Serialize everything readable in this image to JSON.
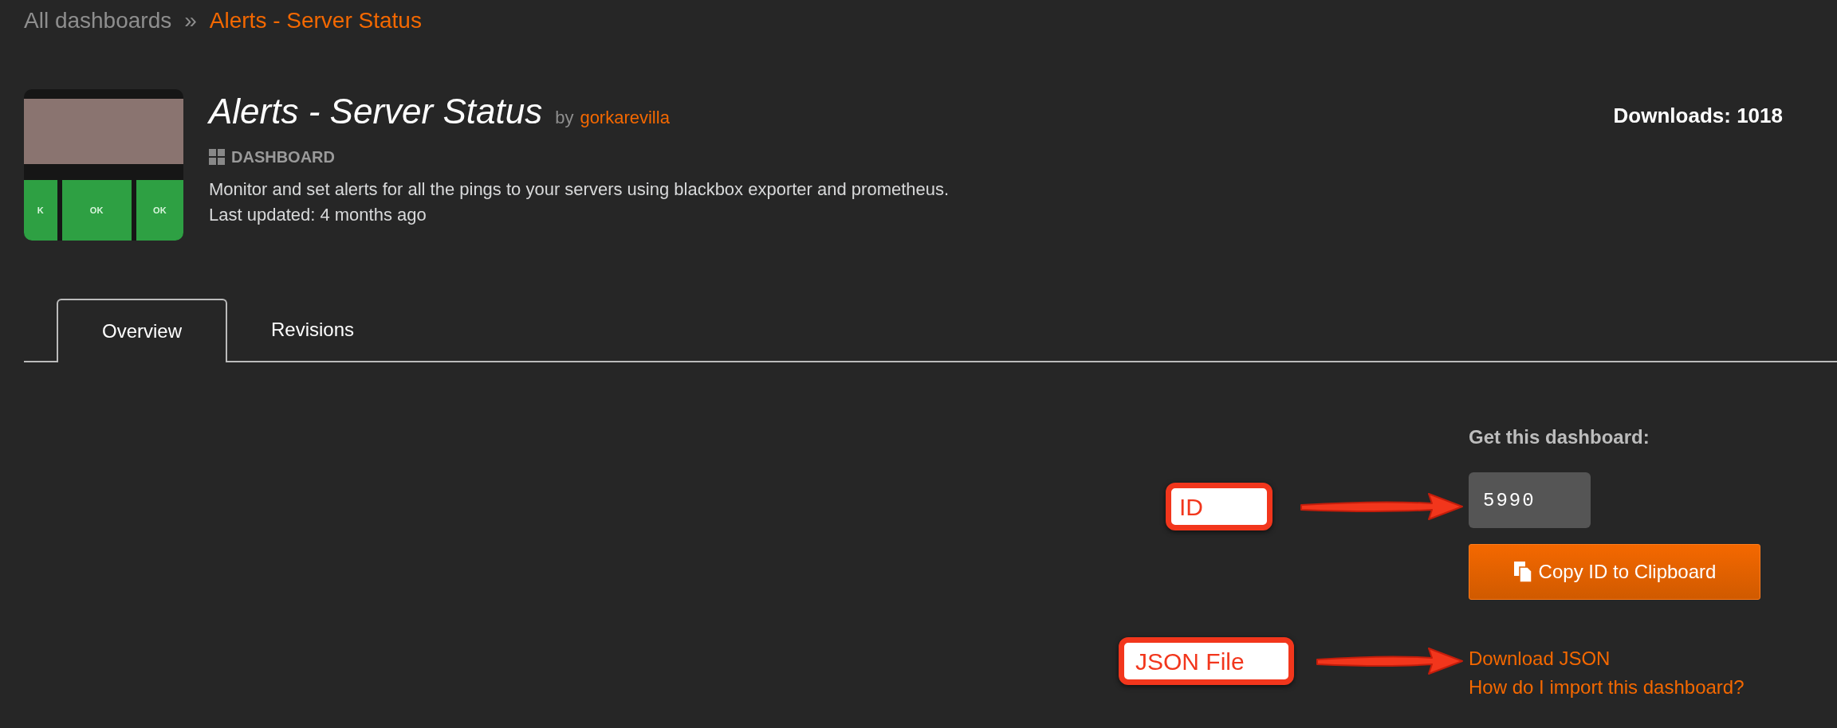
{
  "breadcrumb": {
    "parent": "All dashboards",
    "separator": "»",
    "current": "Alerts - Server Status"
  },
  "thumbnail": {
    "tiles": [
      "K",
      "OK",
      "OK"
    ]
  },
  "header": {
    "title": "Alerts - Server Status",
    "by": "by",
    "author": "gorkarevilla",
    "type": "DASHBOARD",
    "description": "Monitor and set alerts for all the pings to your servers using blackbox exporter and prometheus.",
    "updated": "Last updated: 4 months ago",
    "downloads": "Downloads: 1018"
  },
  "tabs": [
    {
      "label": "Overview",
      "selected": true
    },
    {
      "label": "Revisions",
      "selected": false
    }
  ],
  "get": {
    "heading": "Get this dashboard:",
    "id": "5990",
    "copy_button": "Copy ID to Clipboard",
    "links": [
      "Download JSON",
      "How do I import this dashboard?"
    ]
  },
  "annotations": [
    {
      "label": "ID"
    },
    {
      "label": "JSON File"
    }
  ]
}
